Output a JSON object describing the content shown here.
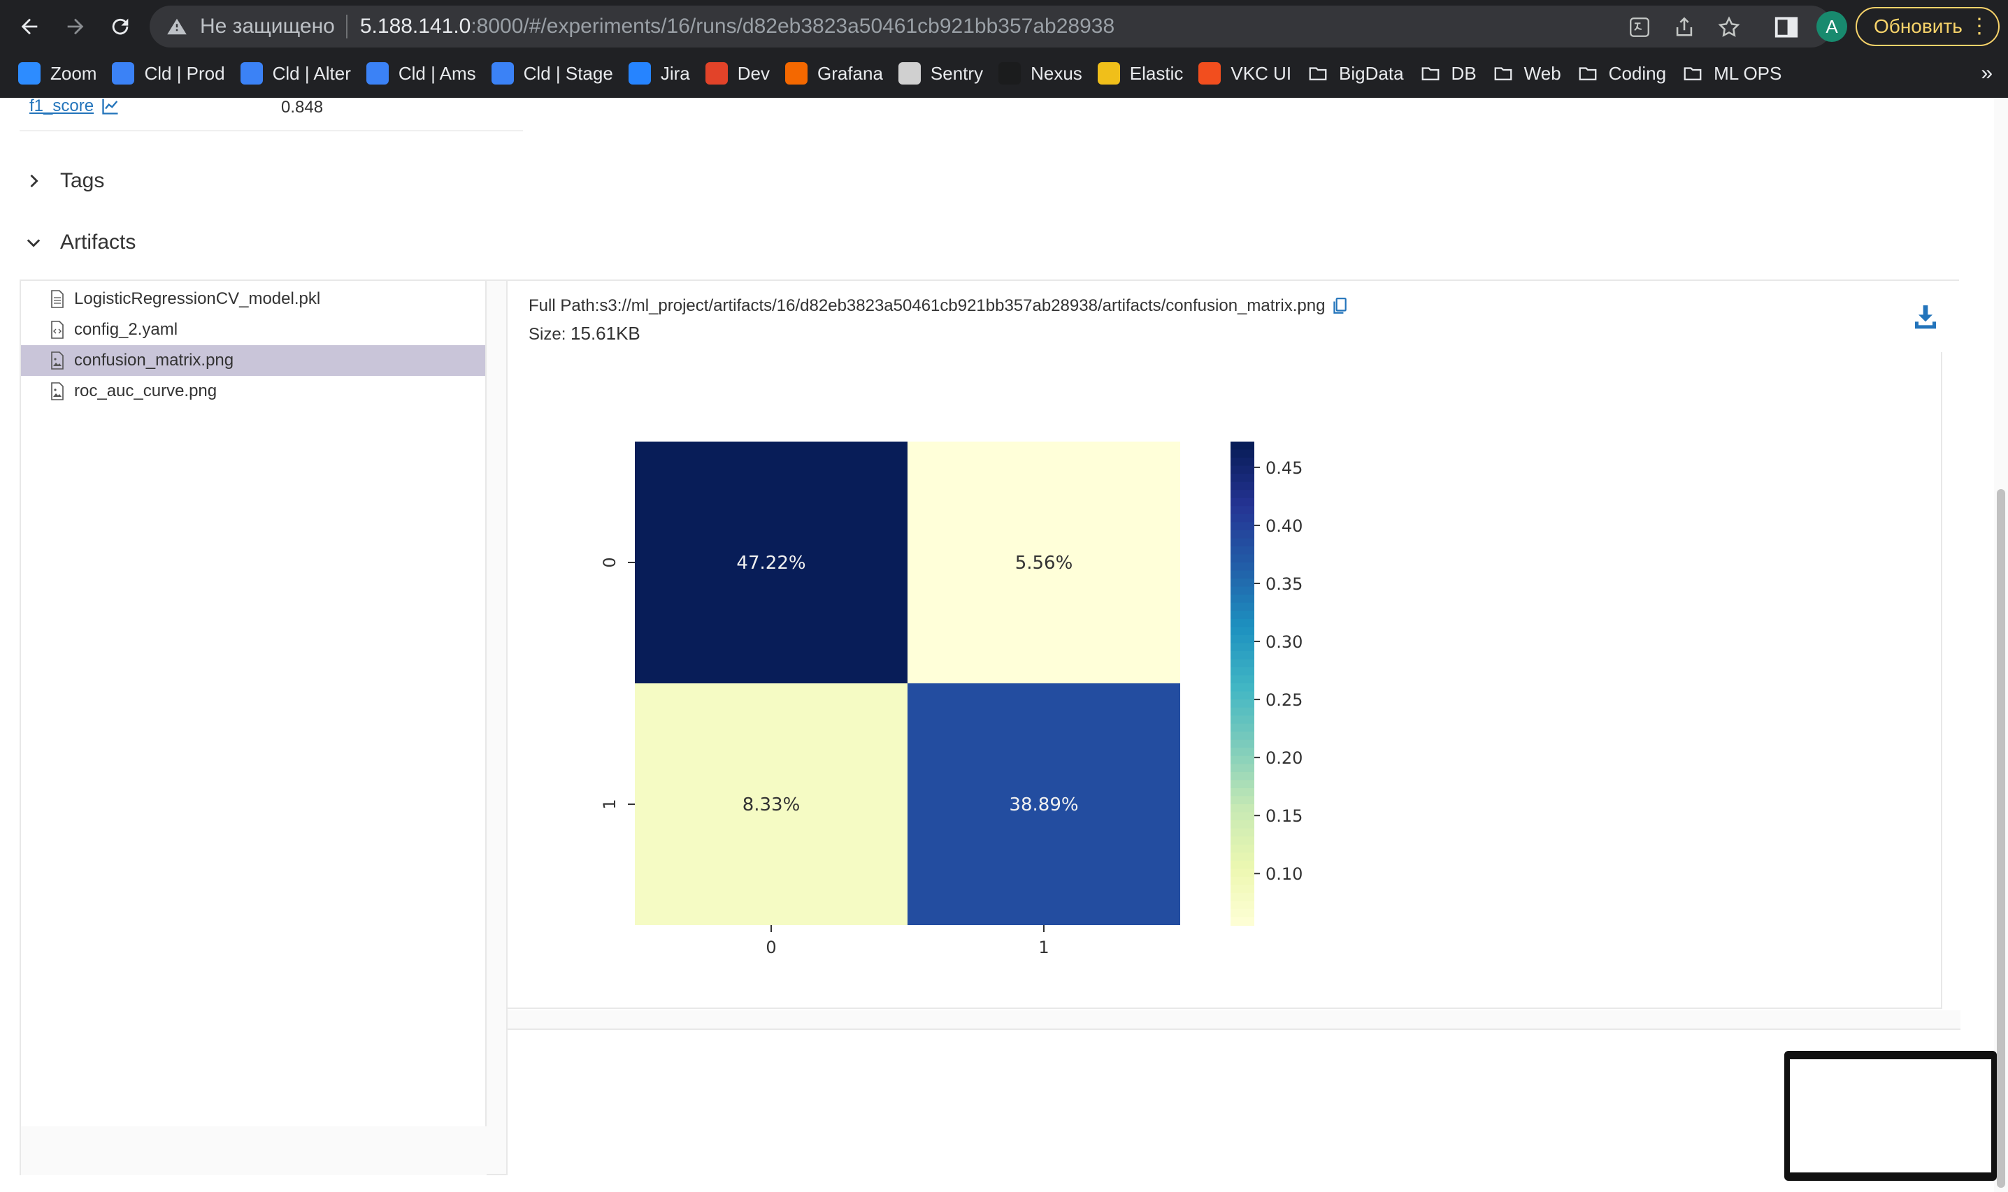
{
  "browser": {
    "insecure_label": "Не защищено",
    "url_host": "5.188.141.0",
    "url_rest": ":8000/#/experiments/16/runs/d82eb3823a50461cb921bb357ab28938",
    "avatar_letter": "A",
    "update_label": "Обновить",
    "bookmarks": [
      {
        "label": "Zoom",
        "icon": "zoom-icon",
        "color": "#2d8cff"
      },
      {
        "label": "Cld | Prod",
        "icon": "cube-icon",
        "color": "#3b82f6"
      },
      {
        "label": "Cld | Alter",
        "icon": "cube-icon",
        "color": "#3b82f6"
      },
      {
        "label": "Cld | Ams",
        "icon": "cube-icon",
        "color": "#3b82f6"
      },
      {
        "label": "Cld | Stage",
        "icon": "cube-icon",
        "color": "#3b82f6"
      },
      {
        "label": "Jira",
        "icon": "jira-icon",
        "color": "#2684ff"
      },
      {
        "label": "Dev",
        "icon": "gitlab-icon",
        "color": "#e24329"
      },
      {
        "label": "Grafana",
        "icon": "grafana-icon",
        "color": "#f46800"
      },
      {
        "label": "Sentry",
        "icon": "sentry-icon",
        "color": "#d0d0d0"
      },
      {
        "label": "Nexus",
        "icon": "nexus-icon",
        "color": "#1b1c1d"
      },
      {
        "label": "Elastic",
        "icon": "elastic-icon",
        "color": "#f0bf1a"
      },
      {
        "label": "VKC UI",
        "icon": "figma-icon",
        "color": "#f24e1e"
      },
      {
        "label": "BigData",
        "icon": "folder-icon",
        "color": "#e8eaed"
      },
      {
        "label": "DB",
        "icon": "folder-icon",
        "color": "#e8eaed"
      },
      {
        "label": "Web",
        "icon": "folder-icon",
        "color": "#e8eaed"
      },
      {
        "label": "Coding",
        "icon": "folder-icon",
        "color": "#e8eaed"
      },
      {
        "label": "ML OPS",
        "icon": "folder-icon",
        "color": "#e8eaed"
      }
    ],
    "more_label": "»"
  },
  "metric": {
    "name": "f1_score",
    "value": "0.848"
  },
  "sections": {
    "tags": "Tags",
    "artifacts": "Artifacts"
  },
  "files": [
    {
      "name": "LogisticRegressionCV_model.pkl",
      "icon": "file-icon",
      "selected": false
    },
    {
      "name": "config_2.yaml",
      "icon": "code-file-icon",
      "selected": false
    },
    {
      "name": "confusion_matrix.png",
      "icon": "image-file-icon",
      "selected": true
    },
    {
      "name": "roc_auc_curve.png",
      "icon": "image-file-icon",
      "selected": false
    }
  ],
  "viewer": {
    "full_path_label": "Full Path:",
    "full_path_value": "s3://ml_project/artifacts/16/d82eb3823a50461cb921bb357ab28938/artifacts/confusion_matrix.png",
    "size_label": "Size:",
    "size_value": "15.61KB"
  },
  "chart_data": {
    "type": "heatmap",
    "rows": [
      "0",
      "1"
    ],
    "cols": [
      "0",
      "1"
    ],
    "values": [
      [
        0.4722,
        0.0556
      ],
      [
        0.0833,
        0.3889
      ]
    ],
    "labels": [
      [
        "47.22%",
        "5.56%"
      ],
      [
        "8.33%",
        "38.89%"
      ]
    ],
    "colormap": "YlGnBu",
    "colorbar_range": [
      0.0556,
      0.4722
    ],
    "colorbar_ticks": [
      "0.45",
      "0.40",
      "0.35",
      "0.30",
      "0.25",
      "0.20",
      "0.15",
      "0.10"
    ],
    "colorbar_tick_values": [
      0.45,
      0.4,
      0.35,
      0.3,
      0.25,
      0.2,
      0.15,
      0.1
    ],
    "title": "",
    "xlabel": "",
    "ylabel": ""
  }
}
